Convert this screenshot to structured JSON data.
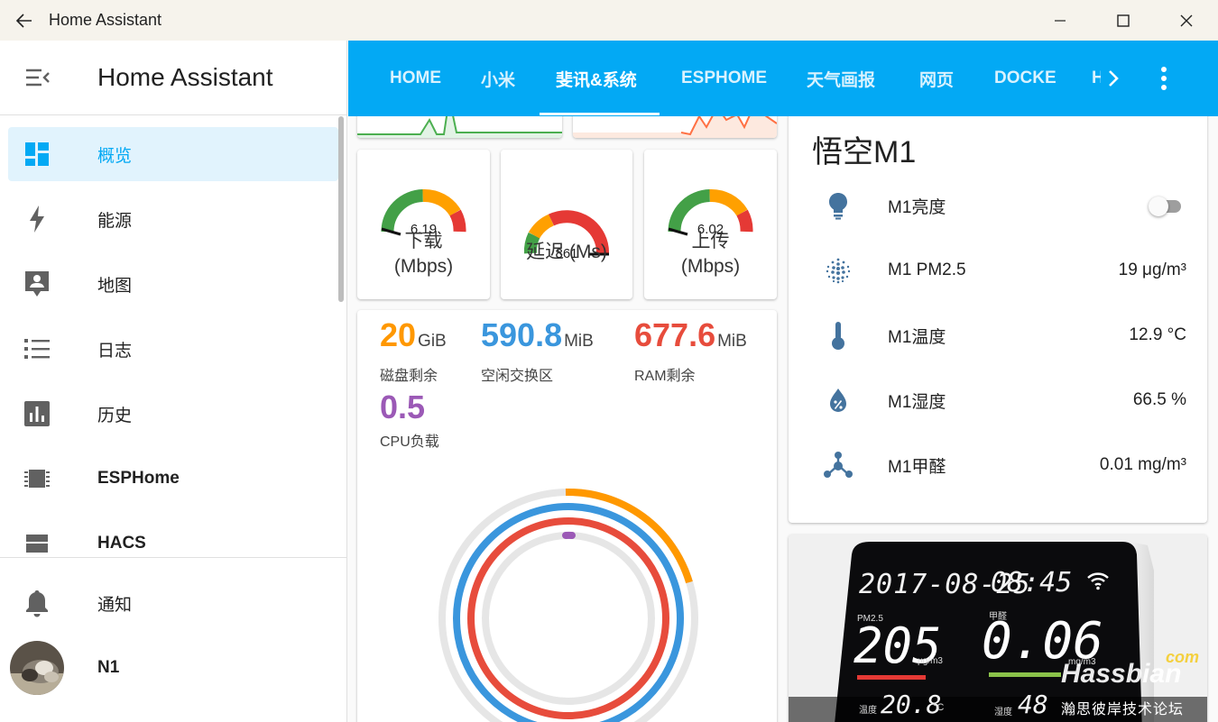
{
  "window": {
    "title": "Home Assistant"
  },
  "sidebar": {
    "title": "Home Assistant",
    "items": [
      {
        "label": "概览",
        "icon": "dashboard-icon",
        "active": true
      },
      {
        "label": "能源",
        "icon": "lightning-bolt-icon"
      },
      {
        "label": "地图",
        "icon": "account-box-icon"
      },
      {
        "label": "日志",
        "icon": "format-list-icon"
      },
      {
        "label": "历史",
        "icon": "chart-box-icon"
      },
      {
        "label": "ESPHome",
        "icon": "chip-icon"
      },
      {
        "label": "HACS",
        "icon": "hacs-icon"
      }
    ],
    "notifications_label": "通知",
    "user_label": "N1"
  },
  "tabs": [
    "HOME",
    "小米",
    "斐讯&系统",
    "ESPHOME",
    "天气画报",
    "网页",
    "DOCKE",
    "H"
  ],
  "active_tab": "斐讯&系统",
  "gauges": [
    {
      "value": "6.19",
      "label_line1": "下载",
      "label_line2": "(Mbps)"
    },
    {
      "value": "861",
      "label_line1": "延迟 (Ms)",
      "label_line2": ""
    },
    {
      "value": "6.02",
      "label_line1": "上传",
      "label_line2": "(Mbps)"
    }
  ],
  "system_stats": [
    {
      "value": "20",
      "unit": "GiB",
      "label": "磁盘剩余",
      "color": "#ff9800"
    },
    {
      "value": "590.8",
      "unit": "MiB",
      "label": "空闲交换区",
      "color": "#3a96dd"
    },
    {
      "value": "677.6",
      "unit": "MiB",
      "label": "RAM剩余",
      "color": "#e74c3c"
    },
    {
      "value": "0.5",
      "unit": "",
      "label": "CPU负载",
      "color": "#9b59b6"
    }
  ],
  "entities_card": {
    "title": "悟空M1",
    "rows": [
      {
        "name": "M1亮度",
        "icon": "lightbulb-icon",
        "value": "",
        "toggle": true
      },
      {
        "name": "M1 PM2.5",
        "icon": "dots-grid-icon",
        "value": "19 μg/m³"
      },
      {
        "name": "M1温度",
        "icon": "thermometer-icon",
        "value": "12.9 °C"
      },
      {
        "name": "M1湿度",
        "icon": "water-percent-icon",
        "value": "66.5 %"
      },
      {
        "name": "M1甲醛",
        "icon": "molecule-icon",
        "value": "0.01 mg/m³"
      }
    ]
  },
  "device_display": {
    "date": "2017-08-25",
    "time": "08:45",
    "pm25_label": "PM2.5",
    "pm25_value": "205",
    "pm25_unit": "μg/m3",
    "hcho_label": "甲醛",
    "hcho_value": "0.06",
    "hcho_unit": "mg/m3",
    "temp_label": "温度",
    "temp_value": "20.8",
    "temp_unit": "°C",
    "hum_label": "湿度",
    "hum_value": "48",
    "watermark_brand": "Hassbian",
    "watermark_com": "com",
    "watermark_sub": "瀚思彼岸技术论坛"
  },
  "colors": {
    "accent": "#03a9f4",
    "active_bg": "#e1f3fd",
    "icon_gray": "#616161"
  }
}
